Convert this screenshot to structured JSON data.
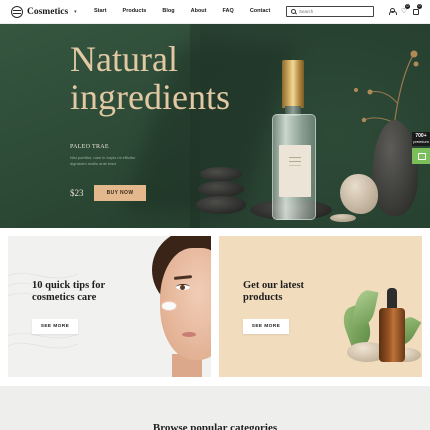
{
  "header": {
    "logo_text": "Cosmetics",
    "logo_caret": "▾",
    "nav": [
      "Start",
      "Products",
      "Blog",
      "About",
      "FAQ",
      "Contact"
    ],
    "search_placeholder": "Search",
    "heart_glyph": "♡",
    "wishlist_count": "0",
    "cart_count": "0"
  },
  "hero": {
    "title": "Natural ingredients",
    "subtitle": "PALEO TRAE",
    "description": "Nisi porttitor, nam in turpis mi efficitur dignissim mollis ante fusci",
    "price": "$23",
    "button_label": "BUY NOW",
    "side_badge_value": "700+",
    "side_badge_label": "premium"
  },
  "promos": [
    {
      "title": "10 quick tips for cosmetics care",
      "button_label": "SEE MORE"
    },
    {
      "title": "Get our latest products",
      "button_label": "SEE MORE"
    }
  ],
  "categories": {
    "title": "Browse popular categories"
  },
  "colors": {
    "hero_green": "#2d4a37",
    "hero_title": "#e2c9a4",
    "accent_button": "#e2b88c",
    "promo_left_bg": "#f1f1ef",
    "promo_right_bg": "#f1dcbd",
    "side_cart": "#7bbf5c"
  },
  "icons": [
    "logo-mark-icon",
    "search-icon",
    "user-icon",
    "heart-icon",
    "bag-icon",
    "cart-icon"
  ]
}
